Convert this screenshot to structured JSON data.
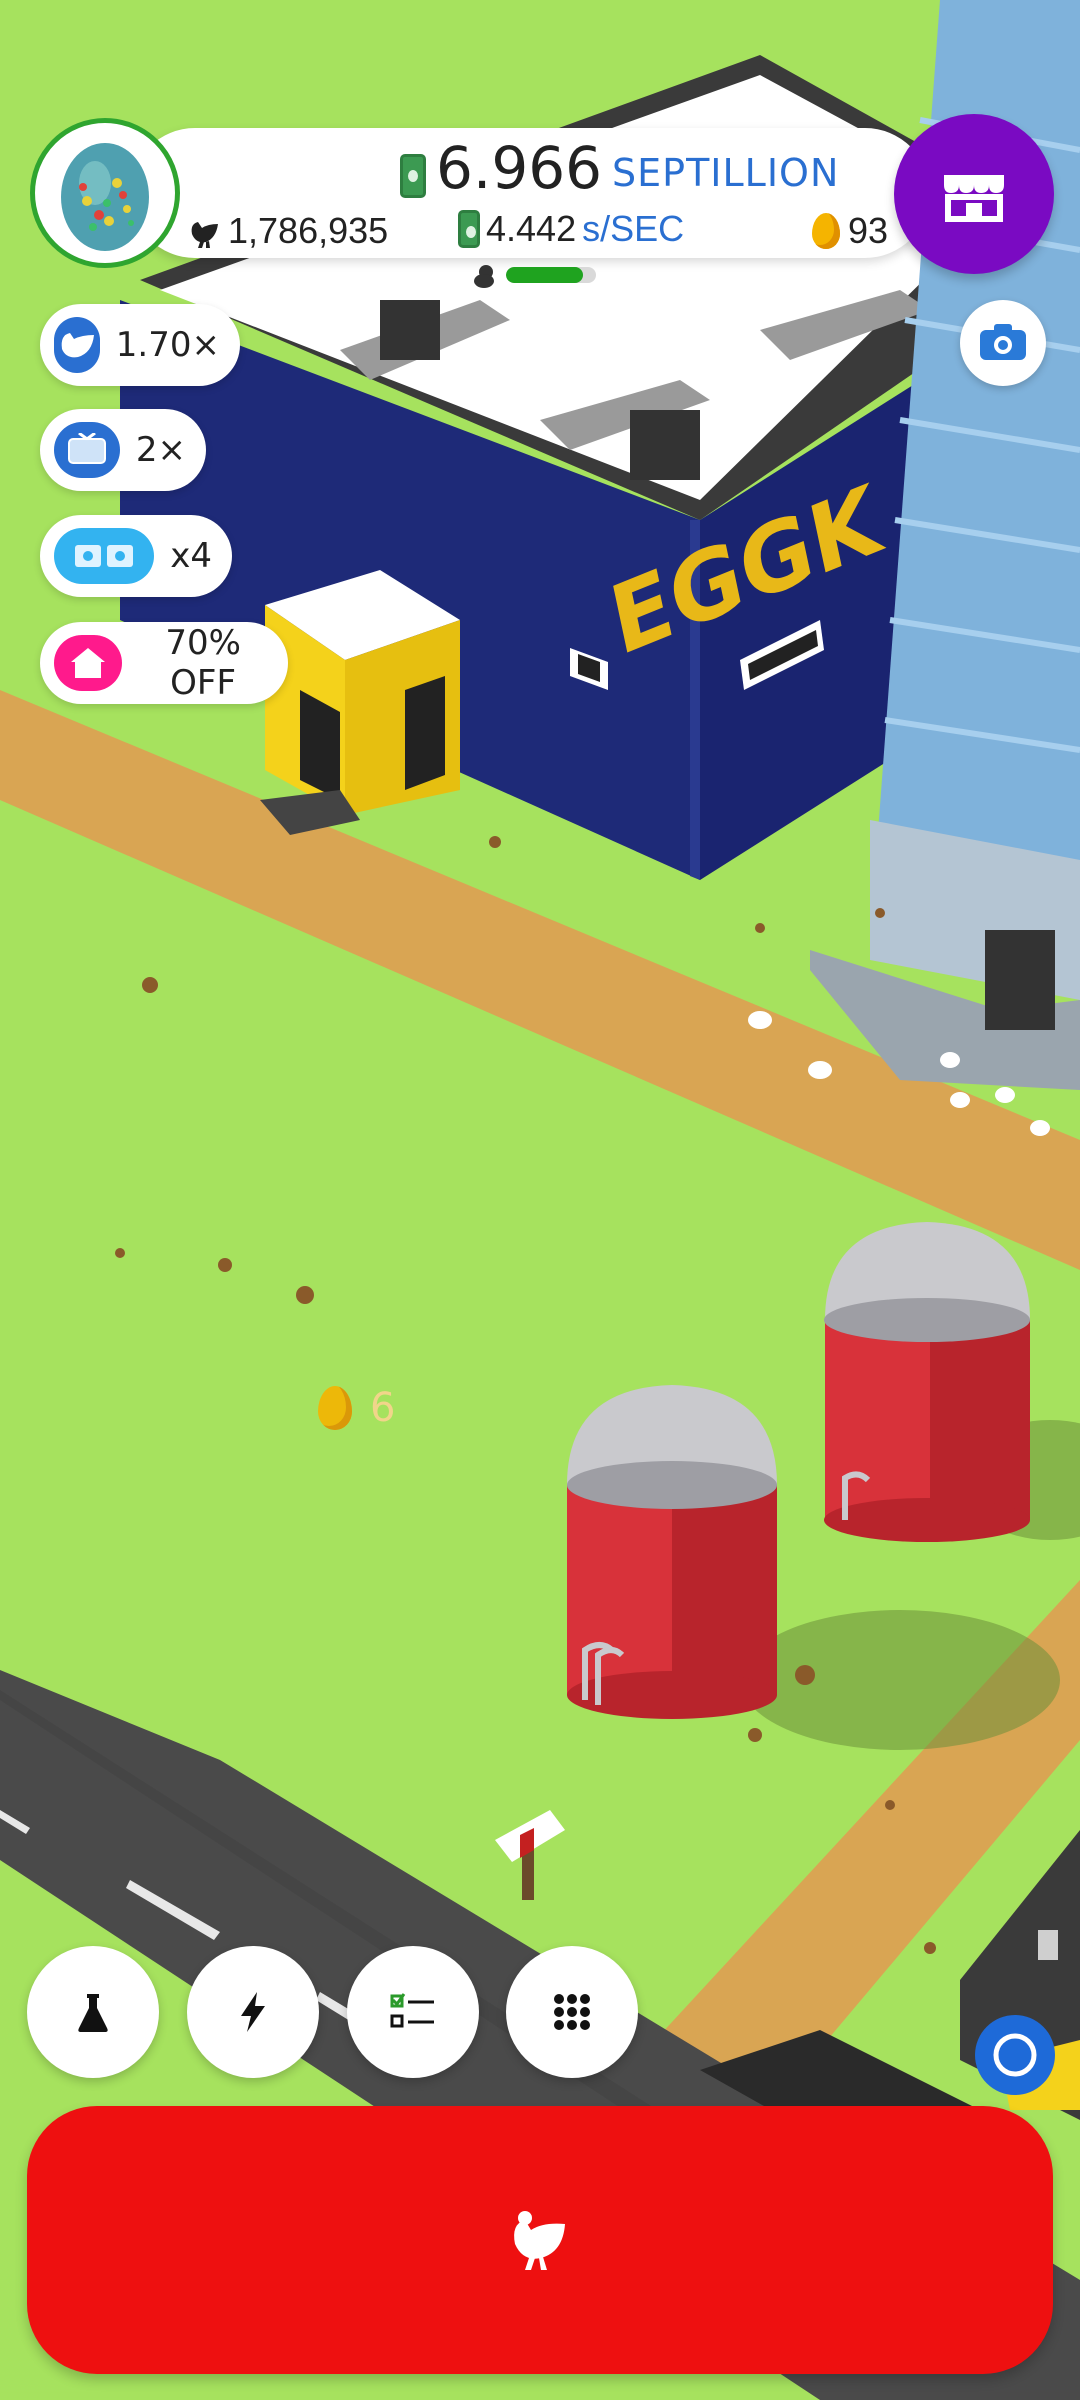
{
  "hud": {
    "money_value": "6.966",
    "money_unit": "SEPTILLION",
    "rate_value": "4.442",
    "rate_unit": "s/SEC",
    "chicken_count": "1,786,935",
    "golden_eggs": "93",
    "hatchery_fill": 0.85
  },
  "boosts": [
    {
      "icon": "chicken-icon",
      "label": "1.70×",
      "color": "#2a6fd1"
    },
    {
      "icon": "video-icon",
      "label": "2×",
      "color": "#2a6fd1"
    },
    {
      "icon": "boost-cards-icon",
      "label": "x4",
      "color": "#33b3f0"
    },
    {
      "icon": "house-icon",
      "label": "70% OFF",
      "color": "#ff1a8c"
    }
  ],
  "scene": {
    "building_sign": "EGGK"
  },
  "floating_reward": {
    "value": "6"
  },
  "nav": [
    "research-icon",
    "boost-icon",
    "missions-icon",
    "menu-grid-icon"
  ],
  "colors": {
    "grass": "#a6e25e",
    "hatch_button": "#ee1010",
    "shop_button": "#7a0ac2",
    "money_unit": "#2a6fd1"
  }
}
